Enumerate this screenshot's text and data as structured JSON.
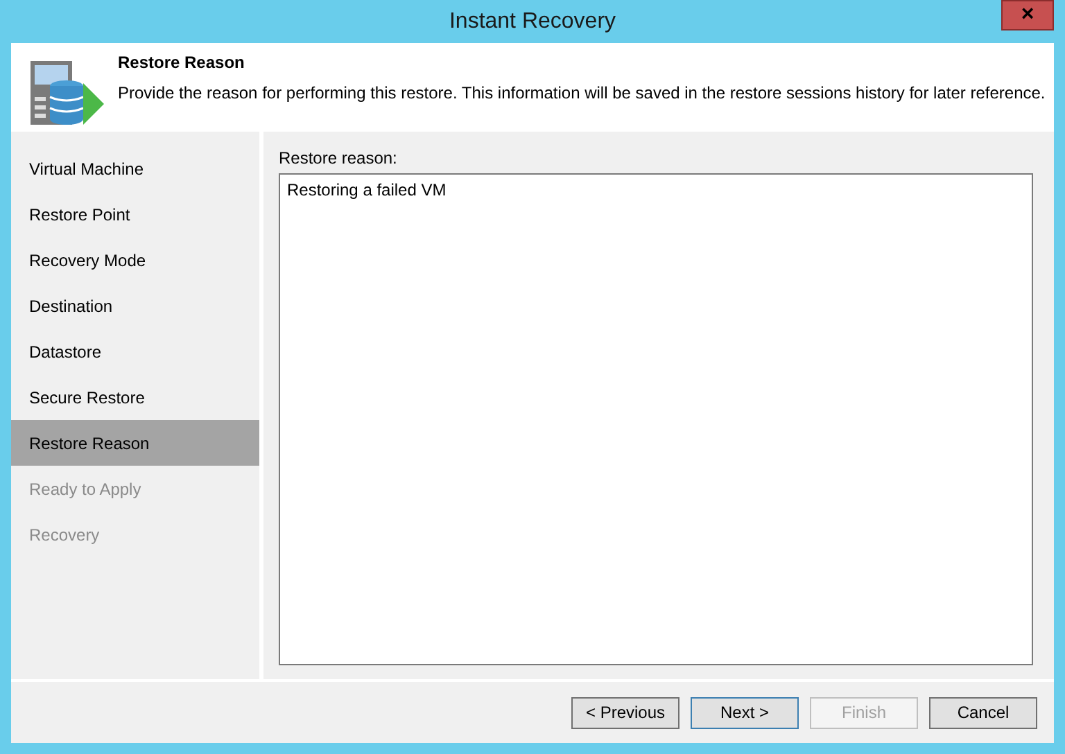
{
  "window": {
    "title": "Instant Recovery",
    "close": "×"
  },
  "header": {
    "title": "Restore Reason",
    "description": "Provide the reason for performing this restore. This information will be saved in the restore sessions history for later reference."
  },
  "steps": [
    {
      "label": "Virtual Machine",
      "selected": false,
      "disabled": false
    },
    {
      "label": "Restore Point",
      "selected": false,
      "disabled": false
    },
    {
      "label": "Recovery Mode",
      "selected": false,
      "disabled": false
    },
    {
      "label": "Destination",
      "selected": false,
      "disabled": false
    },
    {
      "label": "Datastore",
      "selected": false,
      "disabled": false
    },
    {
      "label": "Secure Restore",
      "selected": false,
      "disabled": false
    },
    {
      "label": "Restore Reason",
      "selected": true,
      "disabled": false
    },
    {
      "label": "Ready to Apply",
      "selected": false,
      "disabled": true
    },
    {
      "label": "Recovery",
      "selected": false,
      "disabled": true
    }
  ],
  "reason": {
    "label": "Restore reason:",
    "value": "Restoring a failed VM"
  },
  "buttons": [
    {
      "label": "< Previous",
      "default": false,
      "disabled": false
    },
    {
      "label": "Next >",
      "default": true,
      "disabled": false
    },
    {
      "label": "Finish",
      "default": false,
      "disabled": true
    },
    {
      "label": "Cancel",
      "default": false,
      "disabled": false
    }
  ]
}
